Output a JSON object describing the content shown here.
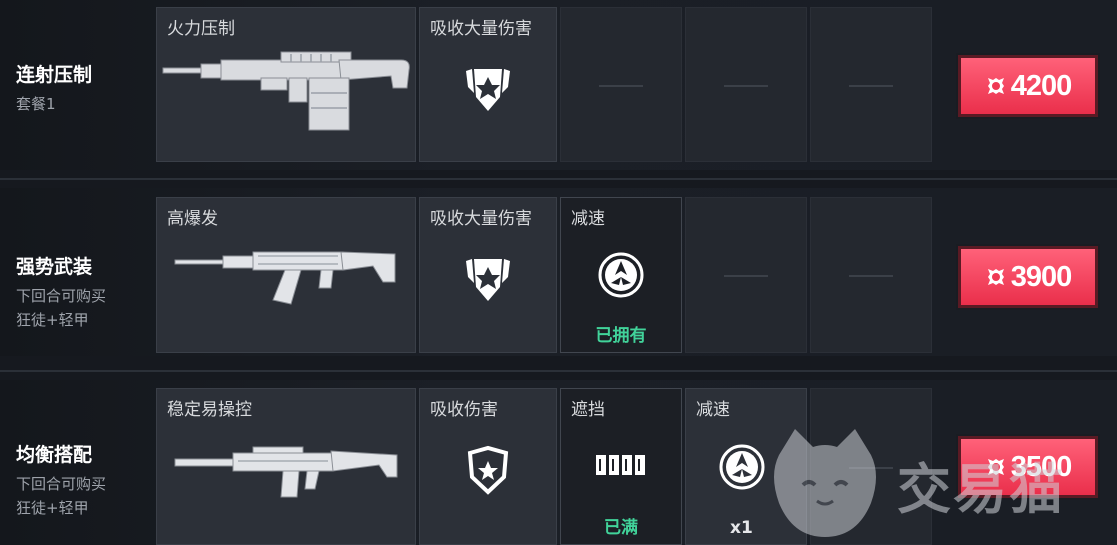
{
  "packages": [
    {
      "title": "连射压制",
      "sub1": "套餐1",
      "sub2": "",
      "weapon_label": "火力压制",
      "armor_label": "吸收大量伤害",
      "price": "4200"
    },
    {
      "title": "强势武装",
      "sub1": "下回合可购买",
      "sub2": "狂徒+轻甲",
      "weapon_label": "高爆发",
      "armor_label": "吸收大量伤害",
      "ability_label": "减速",
      "ability_status": "已拥有",
      "price": "3900"
    },
    {
      "title": "均衡搭配",
      "sub1": "下回合可购买",
      "sub2": "狂徒+轻甲",
      "weapon_label": "稳定易操控",
      "armor_label": "吸收伤害",
      "ability1_label": "遮挡",
      "ability1_status": "已满",
      "ability2_label": "减速",
      "ability2_qty": "x1",
      "price": "3500"
    }
  ],
  "watermark": "交易猫",
  "colors": {
    "price_button": "#ef3a55",
    "owned_text": "#41d39a"
  }
}
